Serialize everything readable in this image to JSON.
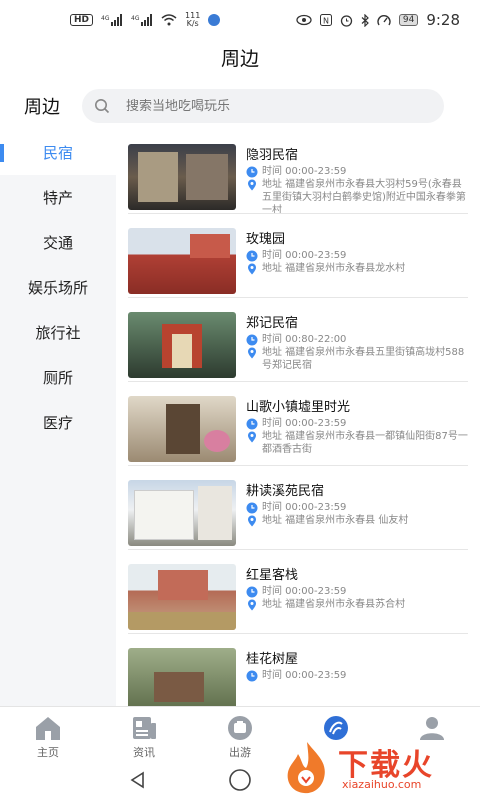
{
  "status_bar": {
    "network_badge": "HD",
    "net_speed_value": "111",
    "net_speed_unit": "K/s",
    "battery": "94",
    "time": "9:28"
  },
  "page_title": "周边",
  "search": {
    "label": "周边",
    "placeholder": "搜索当地吃喝玩乐"
  },
  "categories": [
    "民宿",
    "特产",
    "交通",
    "娱乐场所",
    "旅行社",
    "厕所",
    "医疗"
  ],
  "active_category": "民宿",
  "listings": [
    {
      "name": "隐羽民宿",
      "time": "时间 00:00-23:59",
      "address": "地址 福建省泉州市永春县大羽村59号(永春县五里街镇大羽村白鹤拳史馆)附近中国永春拳第一村"
    },
    {
      "name": "玫瑰园",
      "time": "时间 00:00-23:59",
      "address": "地址 福建省泉州市永春县龙水村"
    },
    {
      "name": "郑记民宿",
      "time": "时间 00:80-22:00",
      "address": "地址 福建省泉州市永春县五里街镇高垅村588号郑记民宿"
    },
    {
      "name": "山歌小镇墟里时光",
      "time": "时间 00:00-23:59",
      "address": "地址 福建省泉州市永春县一都镇仙阳街87号一都酒香古街"
    },
    {
      "name": "耕读溪苑民宿",
      "time": "时间 00:00-23:59",
      "address": "地址 福建省泉州市永春县 仙友村"
    },
    {
      "name": "红星客栈",
      "time": "时间 00:00-23:59",
      "address": "地址 福建省泉州市永春县苏合村"
    },
    {
      "name": "桂花树屋",
      "time": "时间 00:00-23:59",
      "address": ""
    }
  ],
  "tabs": [
    {
      "label": "主页"
    },
    {
      "label": "资讯"
    },
    {
      "label": "出游"
    },
    {
      "label": ""
    },
    {
      "label": ""
    }
  ],
  "watermark": {
    "text": "下载火",
    "sub": "xiazaihuo.com"
  },
  "colors": {
    "accent": "#3d8bf0",
    "watermark": "#e8452a"
  }
}
